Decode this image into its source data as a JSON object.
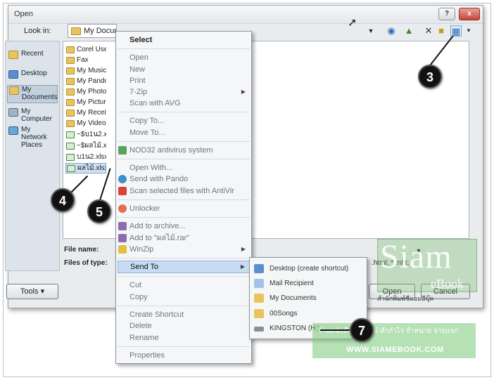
{
  "dialog": {
    "title": "Open",
    "help_label": "?",
    "close_label": "x",
    "look_in_label": "Look in:",
    "look_in_value": "My Documents",
    "file_name_label": "File name:",
    "files_of_type_label": "Files of type:",
    "files_of_type_value": ".html; *.mht;",
    "tools_label": "Tools",
    "open_label": "Open",
    "cancel_label": "Cancel"
  },
  "places": [
    {
      "label": "Recent",
      "icon": "recent-icon"
    },
    {
      "label": "Desktop",
      "icon": "desktop-icon"
    },
    {
      "label": "My Documents",
      "icon": "documents-icon"
    },
    {
      "label": "My Computer",
      "icon": "computer-icon"
    },
    {
      "label": "My Network Places",
      "icon": "network-icon"
    }
  ],
  "files": [
    {
      "label": "Corel Use",
      "kind": "folder"
    },
    {
      "label": "Fax",
      "kind": "folder"
    },
    {
      "label": "My Music",
      "kind": "folder"
    },
    {
      "label": "My Pando",
      "kind": "folder"
    },
    {
      "label": "My Photo",
      "kind": "folder"
    },
    {
      "label": "My Picture",
      "kind": "folder"
    },
    {
      "label": "My Receiv",
      "kind": "folder"
    },
    {
      "label": "My Video",
      "kind": "folder"
    },
    {
      "label": "~$บ1น2.x",
      "kind": "excel"
    },
    {
      "label": "~$ผลไม้.xl",
      "kind": "excel"
    },
    {
      "label": "บ1น2.xlsx",
      "kind": "excel"
    },
    {
      "label": "ผลไม้.xlsx",
      "kind": "excel"
    }
  ],
  "context_menu": {
    "items": [
      {
        "label": "Select",
        "style": "strong"
      },
      {
        "label": "Open"
      },
      {
        "label": "New"
      },
      {
        "label": "Print"
      },
      {
        "label": "7-Zip",
        "submenu": true
      },
      {
        "label": "Scan with AVG"
      },
      {
        "label": "Copy To..."
      },
      {
        "label": "Move To..."
      },
      {
        "label": "NOD32 antivirus system"
      },
      {
        "label": "Open With..."
      },
      {
        "label": "Send with Pando"
      },
      {
        "label": "Scan selected files with AntiVir"
      },
      {
        "label": "Unlocker"
      },
      {
        "label": "Add to archive..."
      },
      {
        "label": "Add to \"ผลไม้.rar\""
      },
      {
        "label": "WinZip",
        "submenu": true
      },
      {
        "label": "Send To",
        "submenu": true,
        "highlighted": true
      },
      {
        "label": "Cut"
      },
      {
        "label": "Copy"
      },
      {
        "label": "Create Shortcut"
      },
      {
        "label": "Delete"
      },
      {
        "label": "Rename"
      },
      {
        "label": "Properties"
      }
    ]
  },
  "send_to_menu": {
    "items": [
      {
        "label": "Desktop (create shortcut)",
        "icon": "desktop-icon"
      },
      {
        "label": "Mail Recipient",
        "icon": "mail-icon"
      },
      {
        "label": "My Documents",
        "icon": "documents-icon"
      },
      {
        "label": "00Songs",
        "icon": "folder-icon"
      },
      {
        "label": "KINGSTON (H:)",
        "icon": "usb-drive-icon"
      }
    ]
  },
  "callouts": [
    "3",
    "4",
    "5",
    "7"
  ],
  "watermark": {
    "title": "Siam",
    "subtitle": "eBook",
    "band_text": "ร้านหนังสือออนไลน์ ทำกำไร จำหน่าย จ่ายแจก",
    "url": "WWW.SIAMEBOOK.COM",
    "small_text": "สำนักพิมพ์ซีแอมอีบุ๊ค"
  },
  "colors": {
    "dialog_bg": "#e9ecef",
    "menu_highlight": "#c7dcf2",
    "watermark_green": "#78c878"
  }
}
